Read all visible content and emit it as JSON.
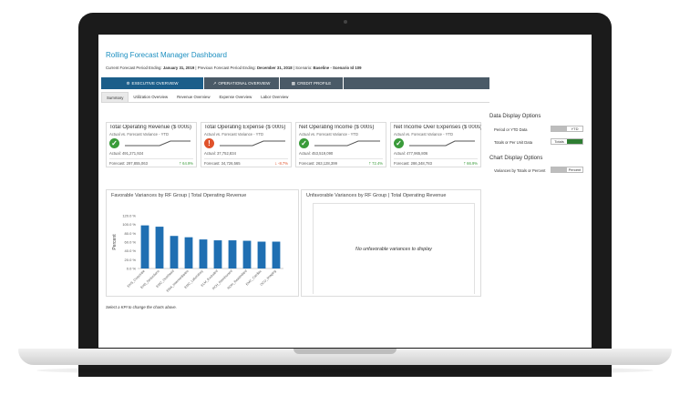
{
  "dashboard": {
    "title": "Rolling Forecast Manager Dashboard",
    "subtitle": {
      "p1": "Current Forecast Period Ending: ",
      "b1": "January 31, 2019",
      "p2": " | Previous Forecast Period Ending: ",
      "b2": "December 31, 2018",
      "p3": " | Scenario: ",
      "b3": "Baseline - Scenario Id 109"
    }
  },
  "main_tabs": [
    {
      "label": "EXECUTIVE OVERVIEW",
      "icon": "gear-icon"
    },
    {
      "label": "OPERATIONAL OVERVIEW",
      "icon": "line-chart-icon"
    },
    {
      "label": "CREDIT PROFILE",
      "icon": "table-icon"
    }
  ],
  "sub_tabs": [
    {
      "label": "Summary"
    },
    {
      "label": "Utilization Overview"
    },
    {
      "label": "Revenue Overview"
    },
    {
      "label": "Expense Overview"
    },
    {
      "label": "Labor Overview"
    }
  ],
  "kpis": [
    {
      "title": "Total Operating Revenue ($ 000s)",
      "sub": "Actual vs. Forecast Variance - YTD",
      "status": "good",
      "status_color": "#3a9b3a",
      "actual": "Actual: 491,271,924",
      "forecast": "Forecast: 297,855,063",
      "pct": "64.9%",
      "pct_dir": "up",
      "pct_color": "#3a9b3a"
    },
    {
      "title": "Total Operating Expense ($ 000s)",
      "sub": "Actual vs. Forecast Variance - YTD",
      "status": "bad",
      "status_color": "#e0522b",
      "actual": "Actual: 37,752,834",
      "forecast": "Forecast: 34,726,565",
      "pct": "-8.7%",
      "pct_dir": "down",
      "pct_color": "#e0522b"
    },
    {
      "title": "Net Operating Income ($ 000s)",
      "sub": "Actual vs. Forecast Variance - YTD",
      "status": "good",
      "status_color": "#3a9b3a",
      "actual": "Actual: 453,519,090",
      "forecast": "Forecast: 263,128,399",
      "pct": "72.4%",
      "pct_dir": "up",
      "pct_color": "#3a9b3a"
    },
    {
      "title": "Net Income Over Expenses ($ 000s)",
      "sub": "Actual vs. Forecast Variance - YTD",
      "status": "good",
      "status_color": "#3a9b3a",
      "actual": "Actual: 477,965,806",
      "forecast": "Forecast: 286,348,783",
      "pct": "66.9%",
      "pct_dir": "up",
      "pct_color": "#3a9b3a"
    }
  ],
  "side": {
    "data_display_title": "Data Display Options",
    "period_label": "Period or YTD Data",
    "period_value": "YTD",
    "totals_label": "Totals or Per Unit Data",
    "totals_value": "Totals",
    "chart_display_title": "Chart Display Options",
    "variances_label": "Variances by Totals or Percent",
    "variances_value": "Percent"
  },
  "favorable_chart": {
    "title": "Favorable Variances by RF Group | Total Operating Revenue"
  },
  "unfavorable_chart": {
    "title": "Unfavorable Variances by RF Group | Total Operating Revenue",
    "empty_text": "No unfavorable variances to display"
  },
  "hint": "Select a KPI to change the charts above.",
  "chart_data": {
    "type": "bar",
    "title": "Favorable Variances by RF Group | Total Operating Revenue",
    "xlabel": "",
    "ylabel": "Percent",
    "categories": [
      "EHS_Corporate",
      "EHS_Deductions",
      "EMC_Overhead",
      "EMA_Intermediaries",
      "EMC_Laboratory",
      "ELM_Excluded",
      "RCH_Reimbursed",
      "ROH_Readmitted",
      "EMC_Cardiac",
      "OCU_Imaging"
    ],
    "values": [
      98,
      95,
      74,
      71,
      66,
      64,
      64,
      63,
      61,
      61
    ],
    "ylim": [
      0,
      120
    ],
    "yticks": [
      "0.0 %",
      "20.0 %",
      "40.0 %",
      "60.0 %",
      "80.0 %",
      "100.0 %",
      "120.0 %"
    ],
    "bar_color": "#1f6fb2",
    "grid": false
  },
  "colors": {
    "accent": "#1c8fc0",
    "active_tab": "#1b5e8a",
    "inactive_tab": "#4a5a67"
  }
}
